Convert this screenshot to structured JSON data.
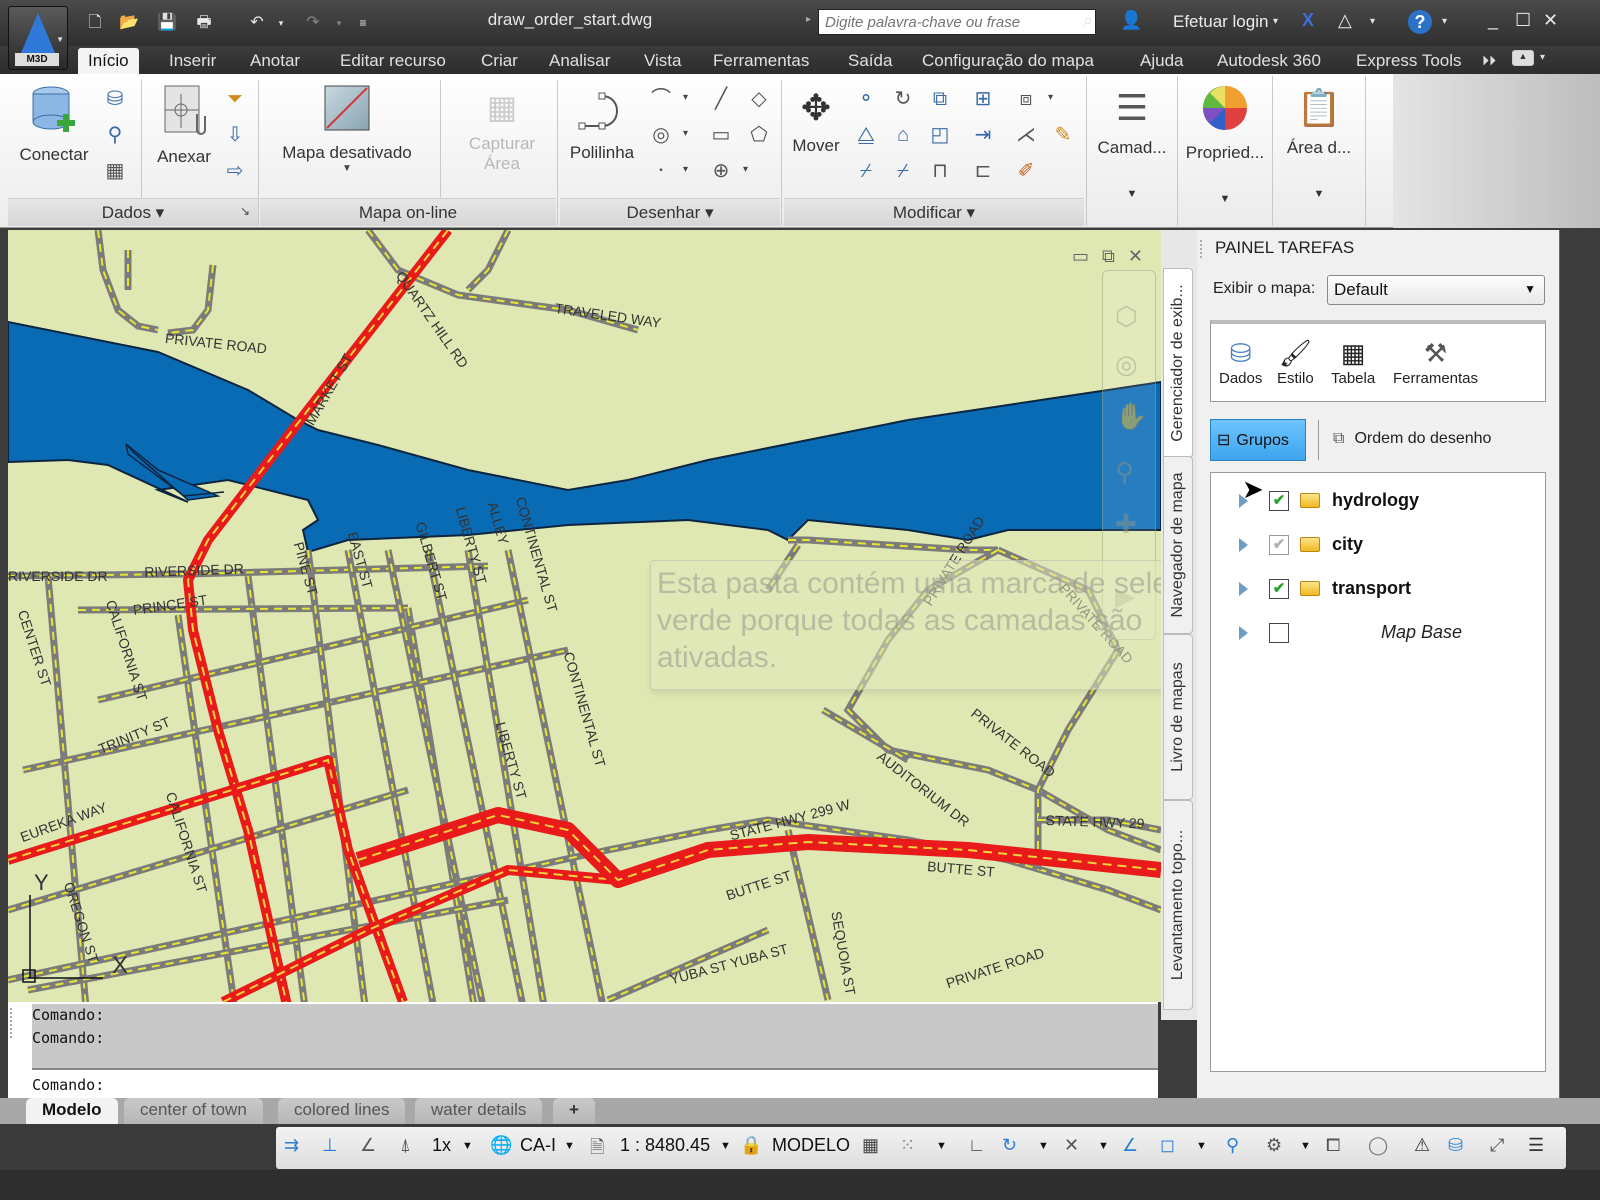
{
  "app": {
    "badge": "M3D",
    "document_title": "draw_order_start.dwg",
    "search_placeholder": "Digite palavra-chave ou frase",
    "login_label": "Efetuar login",
    "quick_access": [
      "new-icon",
      "open-icon",
      "save-icon",
      "print-icon",
      "undo-icon",
      "redo-icon",
      "customize-icon"
    ],
    "window_controls": [
      "minimize",
      "maximize",
      "close"
    ]
  },
  "ribbon": {
    "tabs": [
      {
        "label": "Início",
        "active": true
      },
      {
        "label": "Inserir"
      },
      {
        "label": "Anotar"
      },
      {
        "label": "Editar recurso"
      },
      {
        "label": "Criar"
      },
      {
        "label": "Analisar"
      },
      {
        "label": "Vista"
      },
      {
        "label": "Ferramentas"
      },
      {
        "label": "Saída"
      },
      {
        "label": "Configuração do mapa"
      },
      {
        "label": "Ajuda"
      },
      {
        "label": "Autodesk 360"
      },
      {
        "label": "Express Tools"
      }
    ],
    "panels": {
      "dados": {
        "title": "Dados ▾",
        "conectar": "Conectar",
        "anexar": "Anexar"
      },
      "mapa_online": {
        "title": "Mapa on-line",
        "mapa_desativado": "Mapa desativado",
        "capturar": "Capturar",
        "area": "Área"
      },
      "desenhar": {
        "title": "Desenhar ▾",
        "polilinha": "Polilinha"
      },
      "modificar": {
        "title": "Modificar ▾",
        "mover": "Mover"
      },
      "camadas": {
        "label": "Camad..."
      },
      "propriedades": {
        "label": "Propried..."
      },
      "area_transf": {
        "label": "Área d..."
      }
    }
  },
  "map": {
    "labels": {
      "private_road_1": "PRIVATE ROAD",
      "traveled_way": "TRAVELED WAY",
      "quartz_hill": "QUARTZ HILL RD",
      "market_st": "MARKET ST",
      "riverside_1": "RIVERSIDE DR",
      "riverside_2": "RIVERSIDE DR",
      "prince": "PRINCE ST",
      "center_st": "CENTER ST",
      "california": "CALIFORNIA ST",
      "trinity": "TRINITY ST",
      "alley": "ALLEY",
      "pine": "PINE ST",
      "east": "EAST ST",
      "gilbert": "GILBERT ST",
      "liberty": "LIBERTY ST",
      "continental": "CONTINENTAL ST",
      "eureka": "EUREKA WAY",
      "oregon": "OREGON ST",
      "hwy299": "STATE HWY 299 W",
      "hwy29": "STATE HWY 29",
      "butte1": "BUTTE ST",
      "butte2": "BUTTE ST",
      "auditorium": "AUDITORIUM DR",
      "private_road_2": "PRIVATE ROAD",
      "private_road_3": "PRIVATE ROAD",
      "private_road_4": "PRIVATE ROAD",
      "yuba": "YUBA ST  YUBA ST",
      "sequoia": "SEQUOIA ST"
    },
    "ucs_x": "X",
    "ucs_y": "Y",
    "tooltip": "Esta pasta contém uma marca de seleção verde porque todas as camadas são ativadas."
  },
  "side_tabs": [
    "Gerenciador de exib...",
    "Navegador de mapa",
    "Livro de mapas",
    "Levantamento topo..."
  ],
  "task_pane": {
    "title": "PAINEL TAREFAS",
    "exibir_label": "Exibir o mapa:",
    "exibir_value": "Default",
    "toolbox": [
      {
        "label": "Dados",
        "enabled": true
      },
      {
        "label": "Estilo",
        "enabled": false
      },
      {
        "label": "Tabela",
        "enabled": false
      },
      {
        "label": "Ferramentas",
        "enabled": true
      }
    ],
    "grupos": "Grupos",
    "ordem": "Ordem do desenho",
    "layers": [
      {
        "name": "hydrology",
        "checked": "green"
      },
      {
        "name": "city",
        "checked": "grey"
      },
      {
        "name": "transport",
        "checked": "green"
      },
      {
        "name": "Map Base",
        "checked": "none"
      }
    ]
  },
  "command": {
    "history": [
      "Comando:",
      "Comando:"
    ],
    "prompt": "Comando:"
  },
  "layout_tabs": [
    {
      "label": "Modelo",
      "active": true
    },
    {
      "label": "center of town"
    },
    {
      "label": "colored lines"
    },
    {
      "label": "water details"
    },
    {
      "label": "+"
    }
  ],
  "status": {
    "annoscale": "1x",
    "coord_system": "CA-I",
    "scale": "1 : 8480.45",
    "space": "MODELO"
  }
}
